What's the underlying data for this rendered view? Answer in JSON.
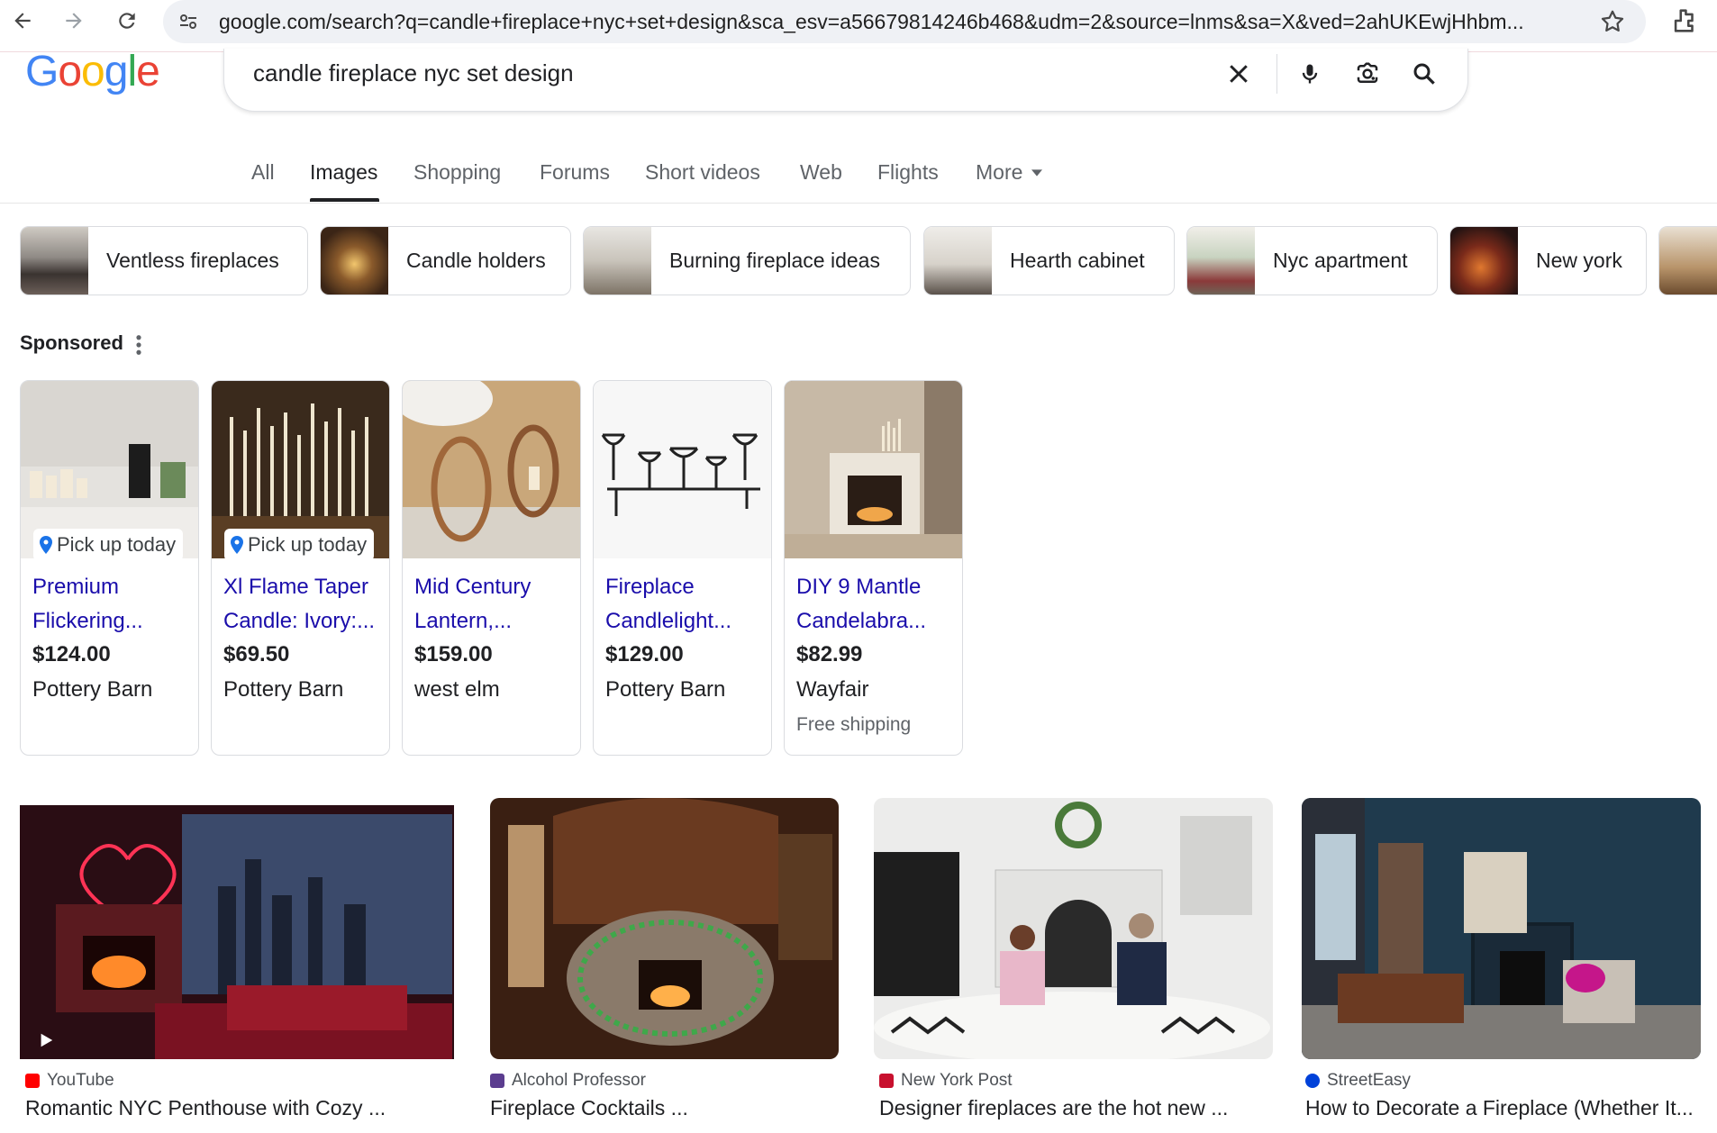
{
  "browser": {
    "url": "google.com/search?q=candle+fireplace+nyc+set+design&sca_esv=a56679814246b468&udm=2&source=lnms&sa=X&ved=2ahUKEwjHhbm..."
  },
  "logo": {
    "letters": [
      "G",
      "o",
      "o",
      "g",
      "l",
      "e"
    ]
  },
  "search": {
    "query": "candle fireplace nyc set design"
  },
  "tabs": [
    "All",
    "Images",
    "Shopping",
    "Forums",
    "Short videos",
    "Web",
    "Flights",
    "More"
  ],
  "chips": [
    "Ventless fireplaces",
    "Candle holders",
    "Burning fireplace ideas",
    "Hearth cabinet",
    "Nyc apartment",
    "New york"
  ],
  "sponsored": {
    "label": "Sponsored",
    "products": [
      {
        "title1": "Premium",
        "title2": "Flickering...",
        "price": "$124.00",
        "store": "Pottery Barn",
        "pickup": "Pick up today",
        "shipping": ""
      },
      {
        "title1": "Xl Flame Taper",
        "title2": "Candle: Ivory:...",
        "price": "$69.50",
        "store": "Pottery Barn",
        "pickup": "Pick up today",
        "shipping": ""
      },
      {
        "title1": "Mid Century",
        "title2": "Lantern,...",
        "price": "$159.00",
        "store": "west elm",
        "pickup": "",
        "shipping": ""
      },
      {
        "title1": "Fireplace",
        "title2": "Candlelight...",
        "price": "$129.00",
        "store": "Pottery Barn",
        "pickup": "",
        "shipping": ""
      },
      {
        "title1": "DIY 9 Mantle",
        "title2": "Candelabra...",
        "price": "$82.99",
        "store": "Wayfair",
        "pickup": "",
        "shipping": "Free shipping"
      }
    ]
  },
  "results": [
    {
      "source": "YouTube",
      "title": "Romantic NYC Penthouse with Cozy ...",
      "fav_color": "#ff0000"
    },
    {
      "source": "Alcohol Professor",
      "title": "Fireplace Cocktails ...",
      "fav_color": "#5b3d8f"
    },
    {
      "source": "New York Post",
      "title": "Designer fireplaces are the hot new ...",
      "fav_color": "#c8102e"
    },
    {
      "source": "StreetEasy",
      "title": "How to Decorate a Fireplace (Whether It...",
      "fav_color": "#0041d9"
    }
  ],
  "colors": {
    "link": "#1a0dab",
    "accent_underline": "#202124"
  }
}
